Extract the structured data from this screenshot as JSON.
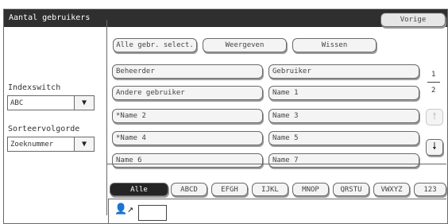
{
  "header": {
    "title": "Aantal gebruikers",
    "back_label": "Vorige"
  },
  "left": {
    "index_label": "Indexswitch",
    "index_value": "ABC",
    "sort_label": "Sorteervolgorde",
    "sort_value": "Zoeknummer"
  },
  "toolbar": {
    "select_all": "Alle gebr. select.",
    "show": "Weergeven",
    "clear": "Wissen"
  },
  "users": [
    "Beheerder",
    "Gebruiker",
    "Andere gebruiker",
    "Name 1",
    "*Name 2",
    "Name 3",
    "*Name 4",
    "Name 5",
    "Name 6",
    "Name 7"
  ],
  "pager": {
    "current": "1",
    "total": "2"
  },
  "index_tabs": [
    "Alle",
    "ABCD",
    "EFGH",
    "IJKL",
    "MNOP",
    "QRSTU",
    "VWXYZ",
    "123"
  ],
  "icons": {
    "up": "arrow-up-icon",
    "down": "arrow-down-icon",
    "user_edit": "user-edit-icon"
  }
}
